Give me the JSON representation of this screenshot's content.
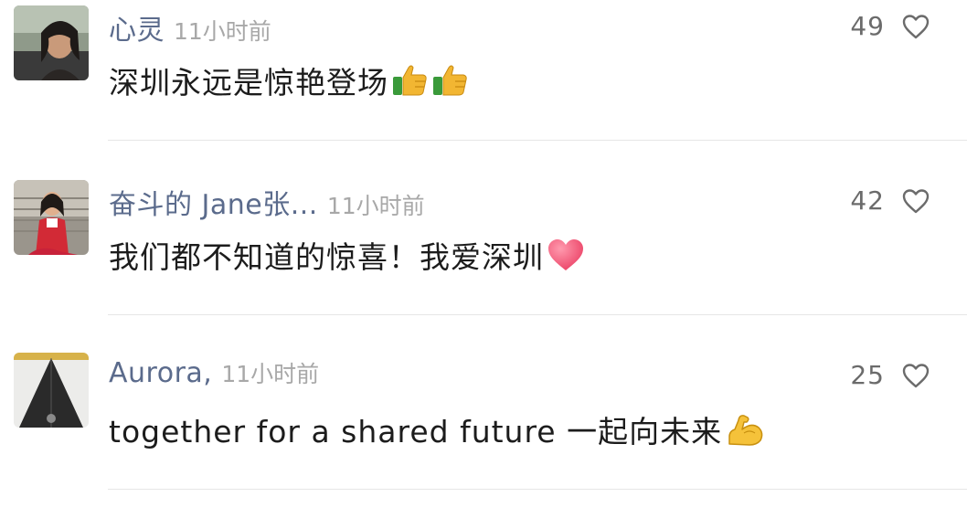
{
  "comments": [
    {
      "username": "心灵",
      "timestamp": "11小时前",
      "likes": "49",
      "text": "深圳永远是惊艳登场",
      "emoji": [
        "thumbs-up-emoji",
        "thumbs-up-emoji"
      ],
      "avatar": "avatar-woman-photo"
    },
    {
      "username": "奋斗的 Jane张...",
      "timestamp": "11小时前",
      "likes": "42",
      "text": "我们都不知道的惊喜！我爱深圳",
      "emoji": [
        "heart-emoji"
      ],
      "avatar": "avatar-girl-photo"
    },
    {
      "username": "Aurora,",
      "timestamp": "11小时前",
      "likes": "25",
      "text": "together for a shared future 一起向未来",
      "emoji": [
        "flexed-biceps-emoji"
      ],
      "avatar": "avatar-triangle-art"
    }
  ],
  "icons": {
    "like": "heart-outline-icon"
  },
  "colors": {
    "username": "#5b6b8c",
    "timestamp": "#a8a8a8",
    "text": "#1c1c1c",
    "like_count": "#6b6b6b",
    "divider": "#e6e6e6"
  }
}
